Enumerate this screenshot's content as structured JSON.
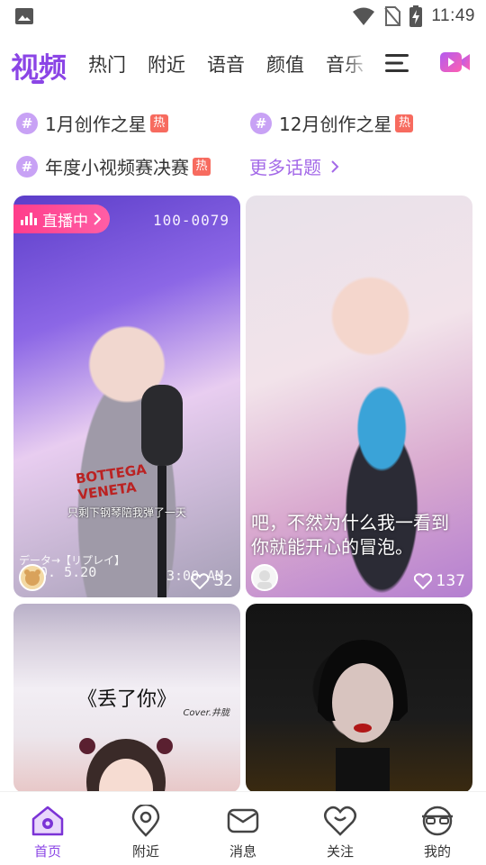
{
  "status_bar": {
    "time": "11:49"
  },
  "top_tabs": [
    {
      "label": "视频",
      "active": true
    },
    {
      "label": "热门"
    },
    {
      "label": "附近"
    },
    {
      "label": "语音"
    },
    {
      "label": "颜值"
    },
    {
      "label": "音乐"
    }
  ],
  "topics": [
    {
      "label": "1月创作之星",
      "badge": "热"
    },
    {
      "label": "12月创作之星",
      "badge": "热"
    },
    {
      "label": "年度小视频赛决赛",
      "badge": "热"
    }
  ],
  "more_topics_label": "更多话题",
  "hash_symbol": "#",
  "cards": [
    {
      "live_label": "直播中",
      "overlay_code": "100-0079",
      "subtitle": "只剩下钢琴陪我弹了一天",
      "stamp_text": "データ→【リプレイ】",
      "date_stamp": "10. 5.20",
      "time_stamp": "3:00 AM",
      "likes": "32",
      "printed_text": "BOTTEGA VENETA"
    },
    {
      "caption": "吧，不然为什么我一看到你就能开心的冒泡。",
      "likes": "137"
    },
    {
      "title": "《丢了你》",
      "credit": "Cover.井胧"
    },
    {}
  ],
  "bottom_nav": [
    {
      "label": "首页",
      "icon": "home-icon",
      "active": true
    },
    {
      "label": "附近",
      "icon": "location-icon"
    },
    {
      "label": "消息",
      "icon": "message-icon"
    },
    {
      "label": "关注",
      "icon": "follow-heart-icon"
    },
    {
      "label": "我的",
      "icon": "profile-icon"
    }
  ],
  "colors": {
    "accent": "#8b45e6",
    "hot_badge": "#f76b5f",
    "live_badge": "#ff3d8b",
    "topic_hash": "#c8a2f5"
  }
}
